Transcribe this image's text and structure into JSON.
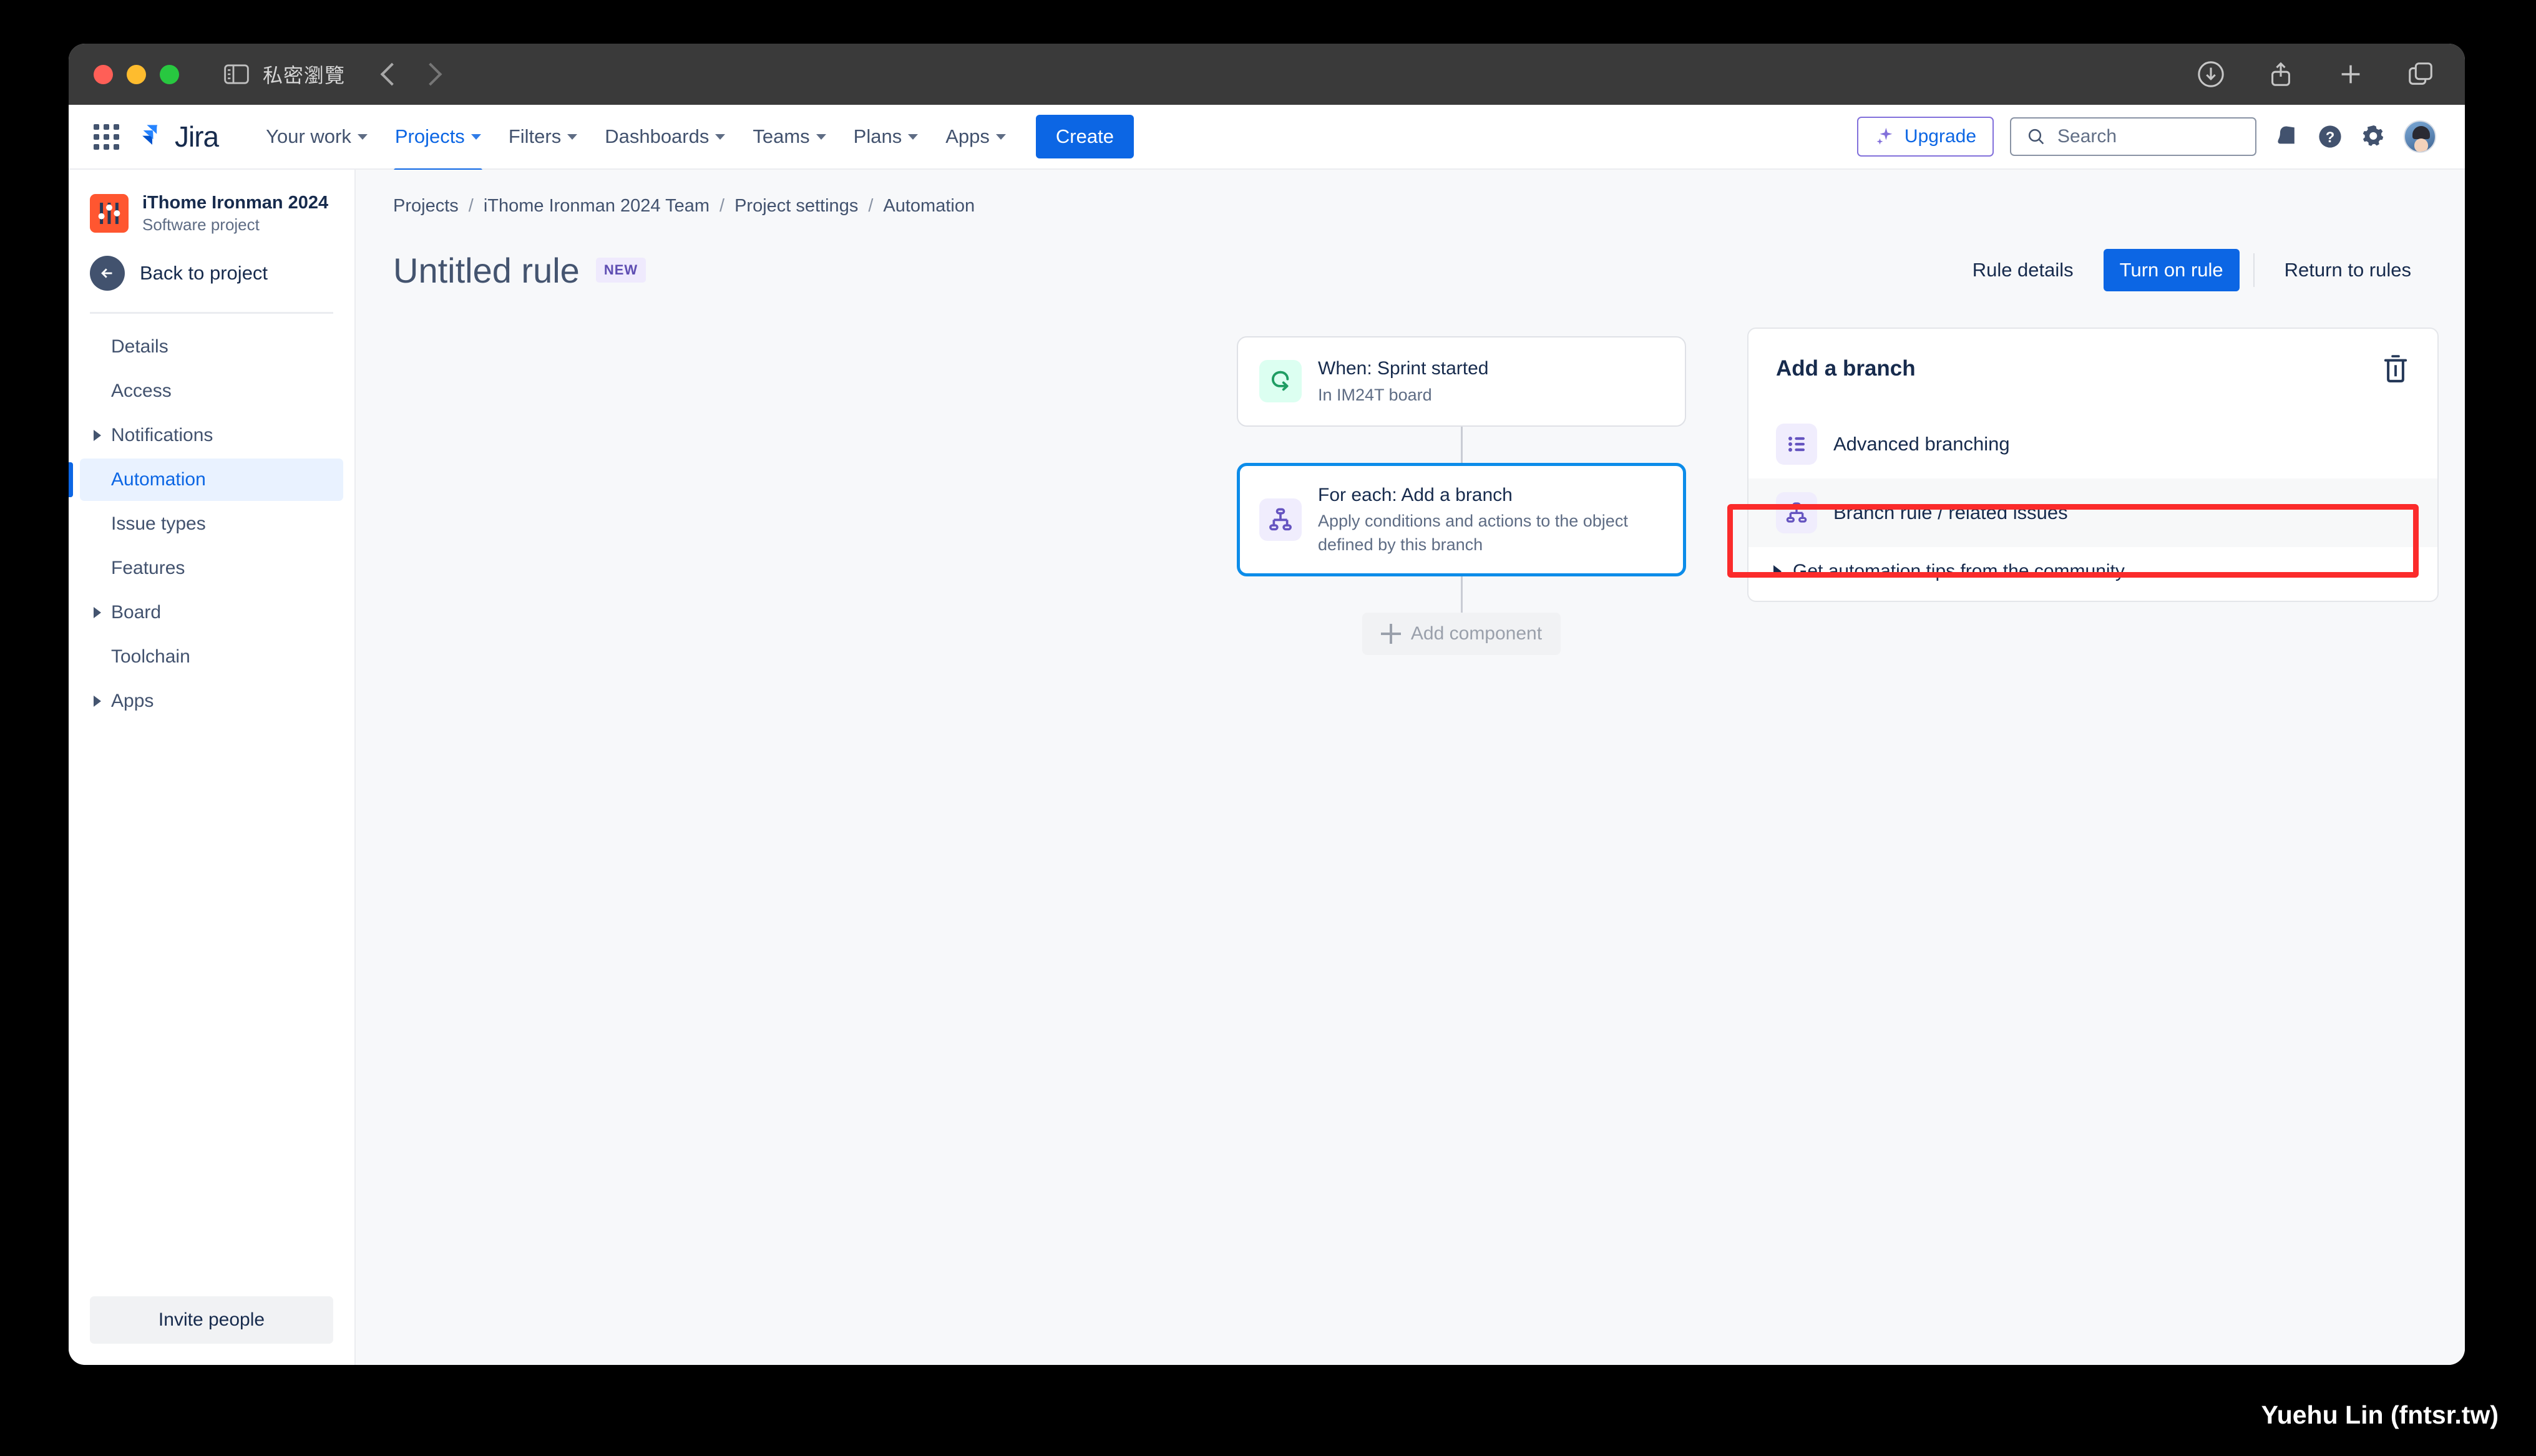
{
  "browser": {
    "private_label": "私密瀏覽",
    "icons": {
      "sidebar_toggle": "sidebar-toggle-icon",
      "back": "back-chevron-icon",
      "forward": "forward-chevron-icon",
      "downloads": "download-icon",
      "share": "share-icon",
      "new_tab": "plus-icon",
      "tab_overview": "tabs-icon"
    }
  },
  "topnav": {
    "logo_text": "Jira",
    "items": [
      {
        "label": "Your work",
        "has_caret": true,
        "active": false
      },
      {
        "label": "Projects",
        "has_caret": true,
        "active": true
      },
      {
        "label": "Filters",
        "has_caret": true,
        "active": false
      },
      {
        "label": "Dashboards",
        "has_caret": true,
        "active": false
      },
      {
        "label": "Teams",
        "has_caret": true,
        "active": false
      },
      {
        "label": "Plans",
        "has_caret": true,
        "active": false
      },
      {
        "label": "Apps",
        "has_caret": true,
        "active": false
      }
    ],
    "create_label": "Create",
    "upgrade_label": "Upgrade",
    "search_placeholder": "Search",
    "accent_blue": "#0C66E4",
    "upgrade_purple": "#8270DB"
  },
  "sidebar": {
    "project_name": "iThome Ironman 2024 ...",
    "project_type": "Software project",
    "back_label": "Back to project",
    "items": [
      {
        "label": "Details",
        "expandable": false,
        "active": false
      },
      {
        "label": "Access",
        "expandable": false,
        "active": false
      },
      {
        "label": "Notifications",
        "expandable": true,
        "active": false
      },
      {
        "label": "Automation",
        "expandable": false,
        "active": true
      },
      {
        "label": "Issue types",
        "expandable": false,
        "active": false
      },
      {
        "label": "Features",
        "expandable": false,
        "active": false
      },
      {
        "label": "Board",
        "expandable": true,
        "active": false
      },
      {
        "label": "Toolchain",
        "expandable": false,
        "active": false
      },
      {
        "label": "Apps",
        "expandable": true,
        "active": false
      }
    ],
    "invite_label": "Invite people",
    "project_color": "#FF5630"
  },
  "breadcrumb": [
    {
      "label": "Projects"
    },
    {
      "label": "iThome Ironman 2024 Team"
    },
    {
      "label": "Project settings"
    },
    {
      "label": "Automation"
    }
  ],
  "page": {
    "title": "Untitled rule",
    "badge": "NEW",
    "actions": {
      "rule_details": "Rule details",
      "turn_on_rule": "Turn on rule",
      "return_to_rules": "Return to rules"
    }
  },
  "canvas": {
    "nodes": [
      {
        "icon": "sprint-started-icon",
        "icon_tone": "green",
        "title": "When: Sprint started",
        "subtitle": "In IM24T board",
        "selected": false
      },
      {
        "icon": "branch-tree-icon",
        "icon_tone": "purple",
        "title": "For each: Add a branch",
        "subtitle": "Apply conditions and actions to the object defined by this branch",
        "selected": true
      }
    ],
    "add_component_label": "Add component"
  },
  "panel": {
    "title": "Add a branch",
    "options": [
      {
        "label": "Advanced branching",
        "icon": "list-bullets-icon",
        "highlighted": false
      },
      {
        "label": "Branch rule / related issues",
        "icon": "branch-tree-icon",
        "highlighted": true
      }
    ],
    "tips_label": "Get automation tips from the community",
    "delete_icon": "trash-icon",
    "annotation_color": "#FB2B2B"
  },
  "watermark": "Yuehu Lin (fntsr.tw)"
}
